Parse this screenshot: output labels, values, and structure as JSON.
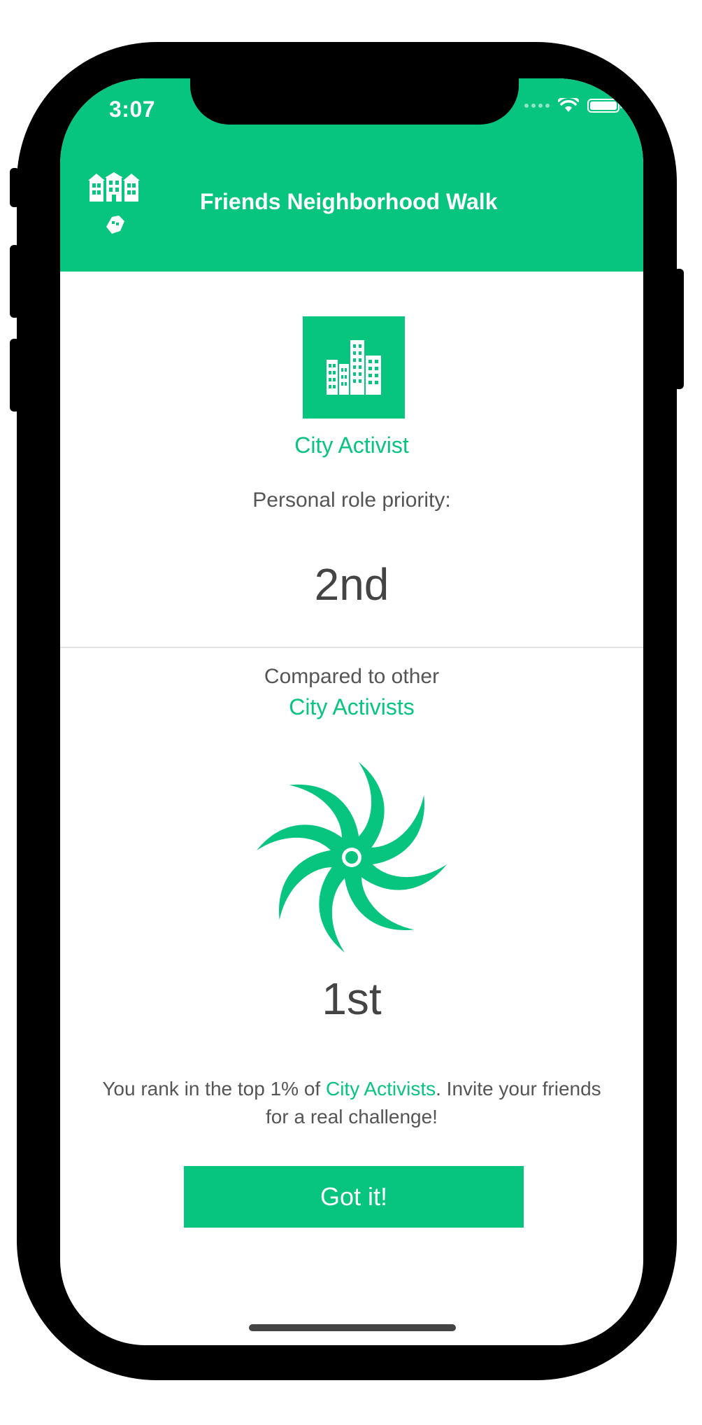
{
  "status_bar": {
    "time": "3:07"
  },
  "header": {
    "title": "Friends Neighborhood Walk",
    "logo_icon": "neighborhood-buildings-icon"
  },
  "role": {
    "icon": "city-buildings-icon",
    "name": "City Activist",
    "priority_label": "Personal role priority:",
    "priority_value": "2nd"
  },
  "comparison": {
    "label": "Compared to other",
    "group": "City Activists",
    "badge_icon": "swirl-badge-icon",
    "rank_value": "1st",
    "message_prefix": "You rank in the top 1% of ",
    "message_group": "City Activists",
    "message_suffix": ". Invite your friends for a real challenge!"
  },
  "actions": {
    "got_it_label": "Got it!"
  },
  "colors": {
    "accent": "#07c47e",
    "text": "#555555",
    "value_text": "#444444",
    "background": "#ffffff"
  }
}
